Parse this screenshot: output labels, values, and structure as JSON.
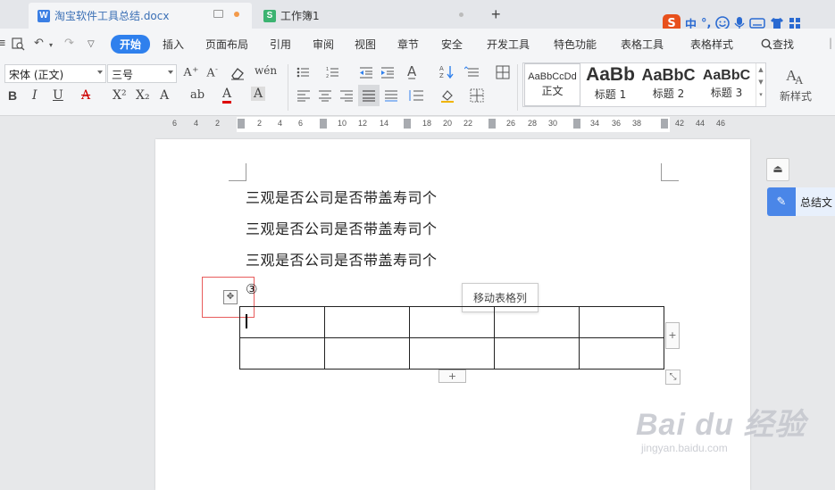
{
  "tabs": [
    {
      "label": "淘宝软件工具总结.docx",
      "icon": "W",
      "icon_color": "#3b7fe4"
    },
    {
      "label": "工作簿1",
      "icon": "S",
      "icon_color": "#3cb371"
    }
  ],
  "newtab": "+",
  "ime": {
    "logo": "S",
    "lang": "中",
    "punct": "°,"
  },
  "menu": {
    "items": [
      "开始",
      "插入",
      "页面布局",
      "引用",
      "审阅",
      "视图",
      "章节",
      "安全",
      "开发工具",
      "特色功能",
      "表格工具",
      "表格样式"
    ],
    "search": "查找"
  },
  "ribbon": {
    "font_name": "宋体 (正文)",
    "font_size": "三号",
    "styles": [
      {
        "sample": "AaBbCcDd",
        "label": "正文"
      },
      {
        "sample": "AaBb",
        "label": "标题 1"
      },
      {
        "sample": "AaBbC",
        "label": "标题 2"
      },
      {
        "sample": "AaBbC",
        "label": "标题 3"
      }
    ],
    "new_style": "新样式"
  },
  "ruler": {
    "ticks": [
      "6",
      "4",
      "2",
      "2",
      "4",
      "6",
      "10",
      "12",
      "14",
      "18",
      "20",
      "22",
      "26",
      "28",
      "30",
      "34",
      "36",
      "38",
      "42",
      "44",
      "46"
    ]
  },
  "document": {
    "paragraphs": [
      "三观是否公司是否带盖寿司个",
      "三观是否公司是否带盖寿司个",
      "三观是否公司是否带盖寿司个"
    ],
    "step": "③",
    "tooltip": "移动表格列",
    "table_rows": 2,
    "table_cols": 5
  },
  "panel": {
    "summary": "总结文"
  },
  "watermark": {
    "brand": "Bai du 经验",
    "url": "jingyan.baidu.com"
  }
}
